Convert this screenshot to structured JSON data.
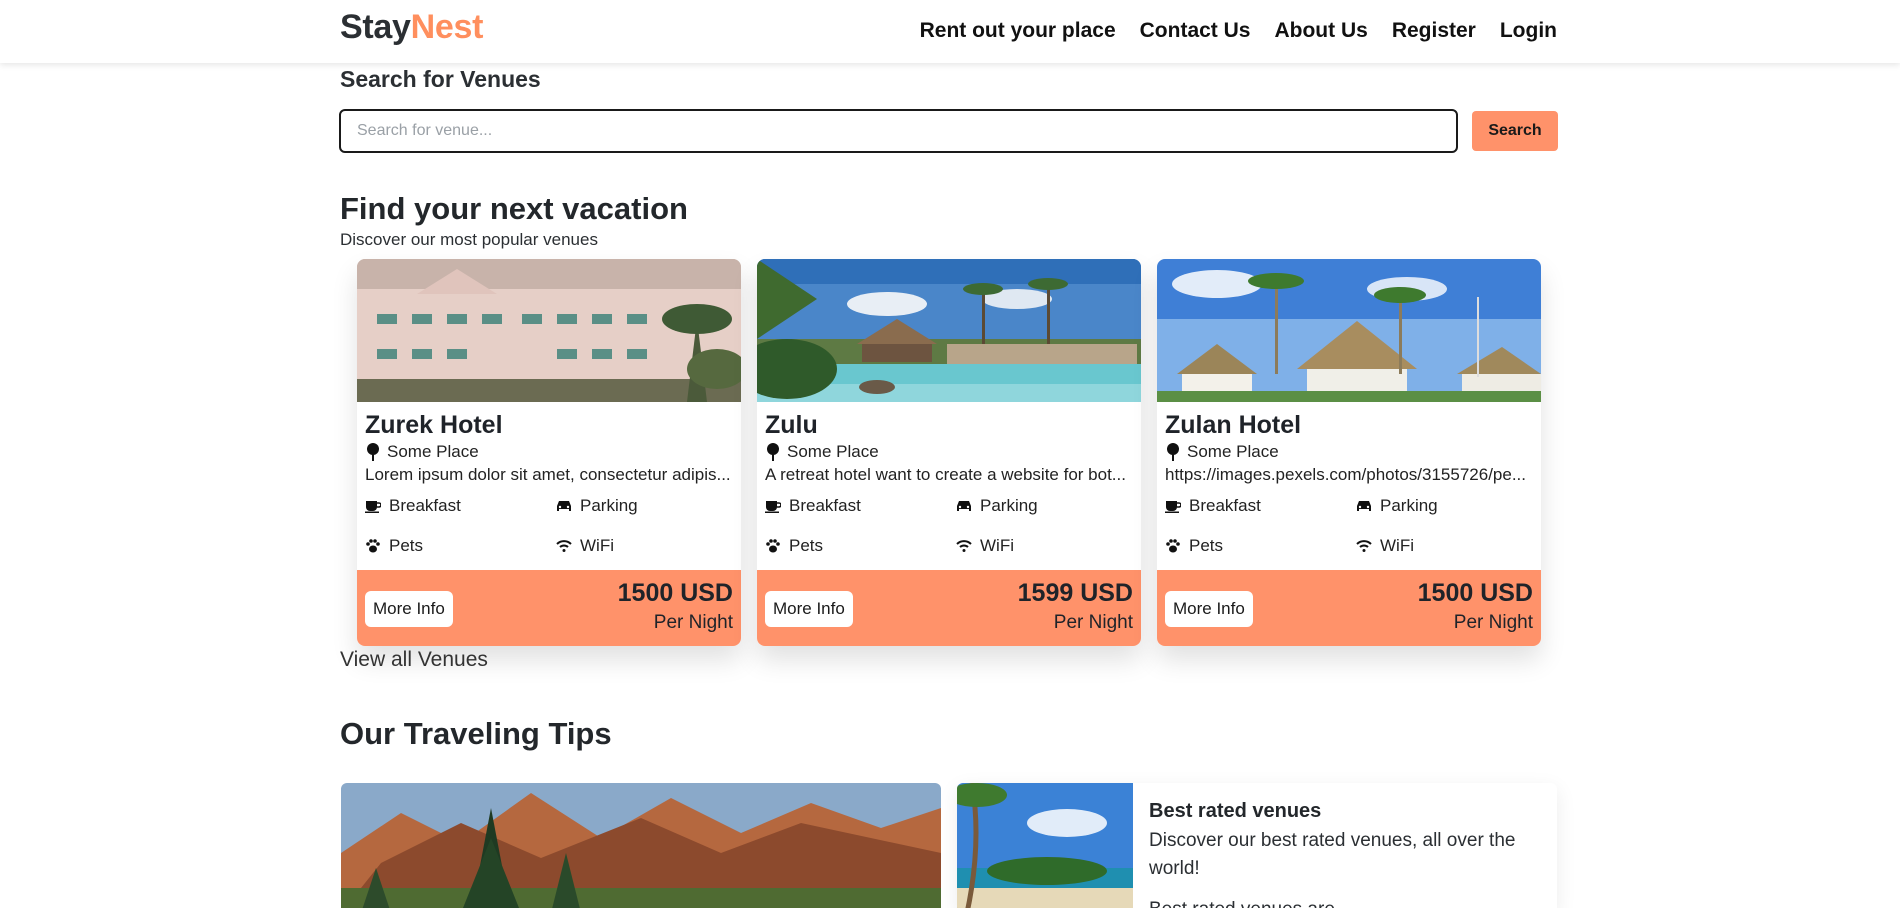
{
  "brand": {
    "part1": "Stay",
    "part2": "Nest",
    "accent": "#ff8f5e"
  },
  "nav": [
    "Rent out your place",
    "Contact Us",
    "About Us",
    "Register",
    "Login"
  ],
  "search": {
    "heading": "Search for Venues",
    "placeholder": "Search for venue...",
    "button": "Search",
    "button_color": "#ff926a"
  },
  "featured": {
    "title": "Find your next vacation",
    "subtitle": "Discover our most popular venues",
    "view_all": "View all Venues",
    "venues": [
      {
        "name": "Zurek Hotel",
        "location": "Some Place",
        "description": "Lorem ipsum dolor sit amet, consectetur adipis...",
        "amenities": [
          "Breakfast",
          "Parking",
          "Pets",
          "WiFi"
        ],
        "button": "More Info",
        "price": "1500 USD",
        "per": "Per Night"
      },
      {
        "name": "Zulu",
        "location": "Some Place",
        "description": "A retreat hotel want to create a website for bot...",
        "amenities": [
          "Breakfast",
          "Parking",
          "Pets",
          "WiFi"
        ],
        "button": "More Info",
        "price": "1599 USD",
        "per": "Per Night"
      },
      {
        "name": "Zulan Hotel",
        "location": "Some Place",
        "description": "https://images.pexels.com/photos/3155726/pe...",
        "amenities": [
          "Breakfast",
          "Parking",
          "Pets",
          "WiFi"
        ],
        "button": "More Info",
        "price": "1500 USD",
        "per": "Per Night"
      }
    ]
  },
  "tips": {
    "title": "Our Traveling Tips",
    "card": {
      "title": "Best rated venues",
      "text": "Discover our best rated venues, all over the world!",
      "more": "Best rated venues are..."
    }
  },
  "icons": {
    "location": "map-pin-icon",
    "breakfast": "coffee-cup-icon",
    "parking": "car-icon",
    "pets": "paw-icon",
    "wifi": "wifi-icon"
  }
}
